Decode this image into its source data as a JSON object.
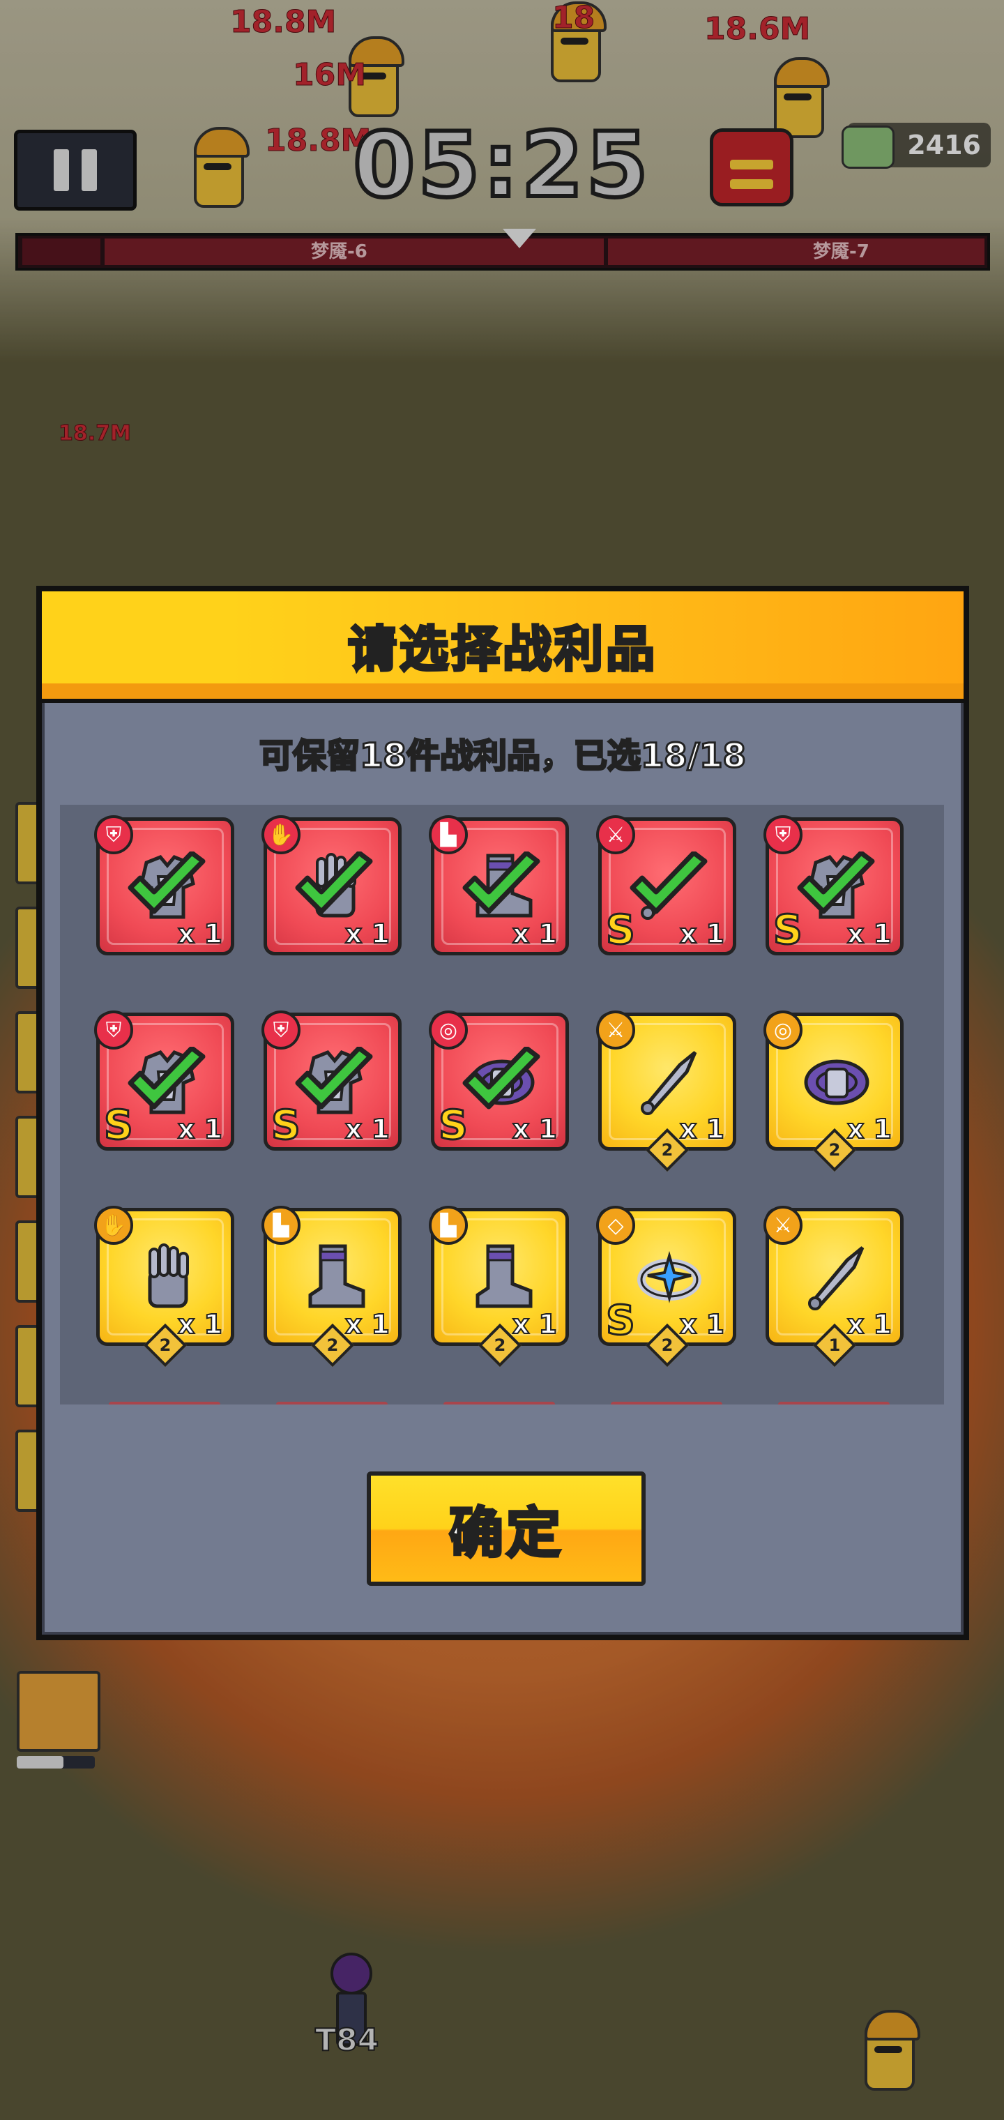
{
  "hud": {
    "timer": "05:25",
    "kill_count": "2416",
    "progress_labels": [
      "梦魇-6",
      "梦魇-7"
    ],
    "damage_popups": [
      "18.8M",
      "18.6M",
      "18.8M",
      "18",
      "16M",
      "18.8M",
      "18.7M"
    ],
    "player_tag": "T84"
  },
  "dialog": {
    "title": "请选择战利品",
    "subtitle": "可保留18件战利品，已选18/18",
    "confirm_label": "确定",
    "items": [
      {
        "slot": "armor-icon",
        "rarity": "red",
        "selected": true,
        "s_rank": false,
        "qty": "x 1",
        "tier": ""
      },
      {
        "slot": "glove-icon",
        "rarity": "red",
        "selected": true,
        "s_rank": false,
        "qty": "x 1",
        "tier": ""
      },
      {
        "slot": "boot-icon",
        "rarity": "red",
        "selected": true,
        "s_rank": false,
        "qty": "x 1",
        "tier": ""
      },
      {
        "slot": "weapon-icon",
        "rarity": "red",
        "selected": true,
        "s_rank": true,
        "qty": "x 1",
        "tier": ""
      },
      {
        "slot": "armor-icon",
        "rarity": "red",
        "selected": true,
        "s_rank": true,
        "qty": "x 1",
        "tier": ""
      },
      {
        "slot": "armor-icon",
        "rarity": "red",
        "selected": true,
        "s_rank": true,
        "qty": "x 1",
        "tier": ""
      },
      {
        "slot": "armor-icon",
        "rarity": "red",
        "selected": true,
        "s_rank": true,
        "qty": "x 1",
        "tier": ""
      },
      {
        "slot": "belt-icon",
        "rarity": "red",
        "selected": true,
        "s_rank": true,
        "qty": "x 1",
        "tier": ""
      },
      {
        "slot": "weapon-icon",
        "rarity": "gold",
        "selected": false,
        "s_rank": false,
        "qty": "x 1",
        "tier": "2"
      },
      {
        "slot": "belt-icon",
        "rarity": "gold",
        "selected": false,
        "s_rank": false,
        "qty": "x 1",
        "tier": "2"
      },
      {
        "slot": "glove-icon",
        "rarity": "gold",
        "selected": false,
        "s_rank": false,
        "qty": "x 1",
        "tier": "2"
      },
      {
        "slot": "boot-icon",
        "rarity": "gold",
        "selected": false,
        "s_rank": false,
        "qty": "x 1",
        "tier": "2"
      },
      {
        "slot": "boot-icon",
        "rarity": "gold",
        "selected": false,
        "s_rank": false,
        "qty": "x 1",
        "tier": "2"
      },
      {
        "slot": "ring-icon",
        "rarity": "gold",
        "selected": false,
        "s_rank": true,
        "qty": "x 1",
        "tier": "2"
      },
      {
        "slot": "weapon-icon",
        "rarity": "gold",
        "selected": false,
        "s_rank": false,
        "qty": "x 1",
        "tier": "1"
      }
    ]
  },
  "colors": {
    "red_rarity": "#f04a55",
    "gold_rarity": "#ffd629",
    "check_green": "#3fc63f",
    "header_yellow": "#ffd21a"
  }
}
